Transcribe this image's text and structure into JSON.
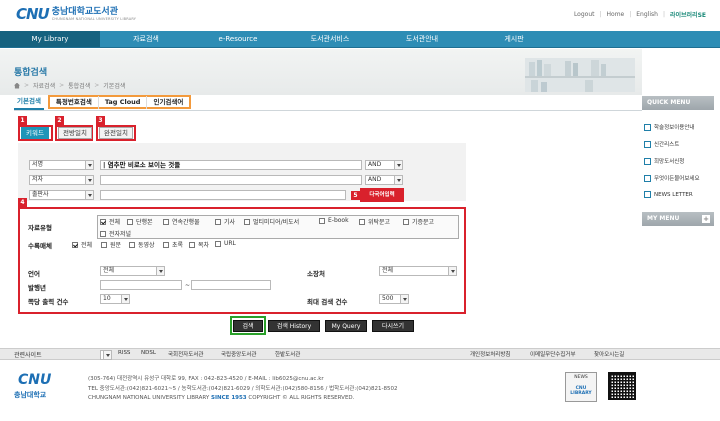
{
  "header": {
    "logo_mark": "CNU",
    "logo_name": "충남대학교도서관",
    "logo_sub": "CHUNGNAM NATIONAL UNIVERSITY LIBRARY",
    "links": [
      "Logout",
      "Home",
      "English",
      "라이브러리SE"
    ]
  },
  "nav": [
    "My Library",
    "자료검색",
    "e-Resource",
    "도서관서비스",
    "도서관안내",
    "게시판"
  ],
  "page": {
    "title": "통합검색",
    "breadcrumb": [
      "자료검색",
      "통합검색",
      "기본검색"
    ]
  },
  "search_tabs": {
    "basic": "기본검색",
    "others": [
      "특정번호검색",
      "Tag Cloud",
      "인기검색어"
    ]
  },
  "modes": [
    "키워드",
    "전방일치",
    "완전일치"
  ],
  "markers": [
    "1",
    "2",
    "3",
    "4",
    "5"
  ],
  "fields": [
    {
      "field": "서명",
      "value": "| 염추만 비로소 보이는 것들",
      "op": "AND"
    },
    {
      "field": "저자",
      "value": "",
      "op": "AND"
    },
    {
      "field": "출판사",
      "value": "",
      "op": ""
    }
  ],
  "dict_button": "다국어입력",
  "filters": {
    "material_label": "자료유형",
    "material_types": [
      {
        "label": "전체",
        "checked": true
      },
      {
        "label": "단행본",
        "checked": false
      },
      {
        "label": "연속간행물",
        "checked": false
      },
      {
        "label": "기사",
        "checked": false
      },
      {
        "label": "멀티미디어/비도서",
        "checked": false
      },
      {
        "label": "E-book",
        "checked": false
      },
      {
        "label": "위탁문고",
        "checked": false
      },
      {
        "label": "기증문고",
        "checked": false
      },
      {
        "label": "전자저널",
        "checked": false
      }
    ],
    "medium_label": "수록매체",
    "media_types": [
      {
        "label": "전체",
        "checked": true
      },
      {
        "label": "원문",
        "checked": false
      },
      {
        "label": "동영상",
        "checked": false
      },
      {
        "label": "초록",
        "checked": false
      },
      {
        "label": "목차",
        "checked": false
      },
      {
        "label": "URL",
        "checked": false
      }
    ],
    "language_label": "언어",
    "language_value": "전체",
    "location_label": "소장처",
    "location_value": "전체",
    "year_label": "발행년",
    "year_sep": "~",
    "page_size_label": "쪽당 출력 건수",
    "page_size_value": "10",
    "max_label": "최대 검색 건수",
    "max_value": "500"
  },
  "buttons": [
    "검색",
    "검색 History",
    "My Query",
    "다시쓰기"
  ],
  "sidebar": {
    "quick_title": "QUICK MENU",
    "quick_items": [
      "학술정보이용안내",
      "신간리스트",
      "희망도서신청",
      "무엇이든물어보세요",
      "NEWS LETTER"
    ],
    "mymenu_title": "MY MENU",
    "mymenu_plus": "+"
  },
  "footer": {
    "related_label": "관련사이트",
    "related_links": [
      "RISS",
      "NDSL",
      "국회전자도서관",
      "국립중앙도서관",
      "한밭도서관"
    ],
    "policy_links": [
      "개인정보처리방침",
      "이메일무단수집거부",
      "찾아오시는길"
    ],
    "logo_mark": "CNU",
    "logo_ko": "충남대학교",
    "address": "(305-764) 대전광역시 유성구 대학로 99, FAX : 042-823-4520 / E-MAIL : lib6025@cnu.ac.kr",
    "tel": "TEL 중앙도서관:(042)821-6021~5 / 농학도서관:(042)821-6029 / 의학도서관:(042)580-8156 / 법학도서관:(042)821-8502",
    "copyright_pre": "CHUNGNAM NATIONAL UNIVERSITY LIBRARY",
    "copyright_since": "SINCE 1953",
    "copyright_post": "COPYRIGHT © ALL RIGHTS RESERVED.",
    "badge_top": "NEWS",
    "badge_text": "CNU LIBRARY"
  }
}
